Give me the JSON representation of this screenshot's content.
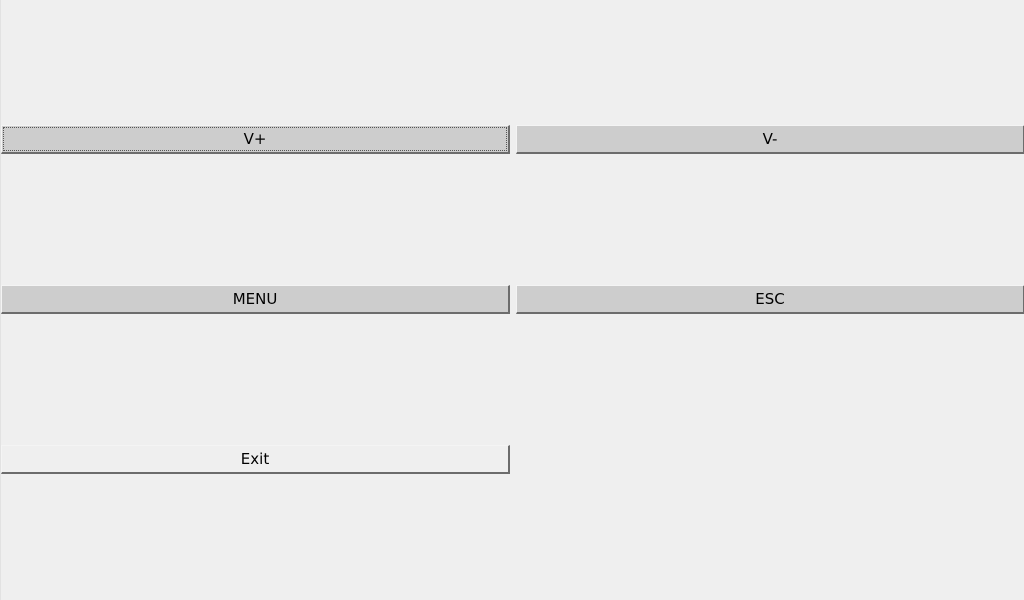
{
  "buttons": {
    "volume_up": "V+",
    "volume_down": "V-",
    "menu": "MENU",
    "escape": "ESC",
    "exit": "Exit"
  }
}
